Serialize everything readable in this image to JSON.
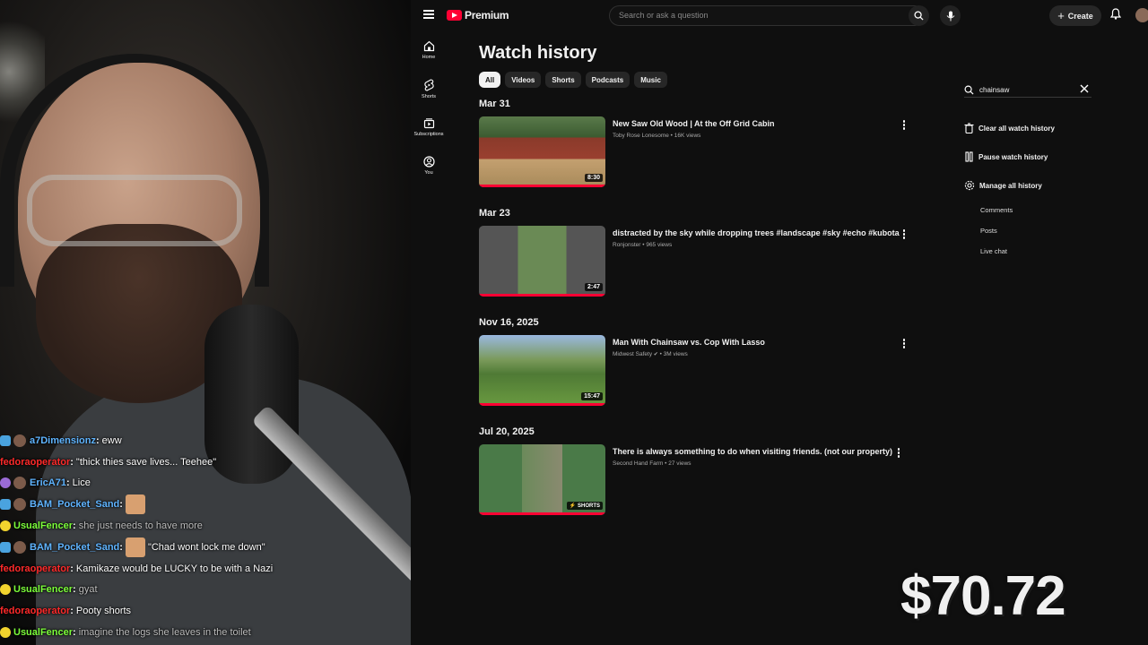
{
  "chat": [
    {
      "user": "a7Dimensionz",
      "color": "#5fb4ff",
      "badge": "sub",
      "avatar": true,
      "message": "eww",
      "faded": false
    },
    {
      "user": "fedoraoperator",
      "color": "#ff2a2a",
      "badge": "",
      "avatar": false,
      "message": "\"thick thies save lives... Teehee\"",
      "faded": false
    },
    {
      "user": "EricA71",
      "color": "#5fb4ff",
      "badge": "purple",
      "avatar": true,
      "message": "Lice",
      "faded": false
    },
    {
      "user": "BAM_Pocket_Sand",
      "color": "#5fb4ff",
      "badge": "sub",
      "avatar": true,
      "message": "",
      "emote": true,
      "faded": false
    },
    {
      "user": "UsualFencer",
      "color": "#7cff3a",
      "badge": "yellow",
      "avatar": false,
      "message": "she just needs to have more",
      "faded": true
    },
    {
      "user": "BAM_Pocket_Sand",
      "color": "#5fb4ff",
      "badge": "sub",
      "avatar": true,
      "message": "\"Chad wont lock me down\"",
      "emote": true,
      "faded": false
    },
    {
      "user": "fedoraoperator",
      "color": "#ff2a2a",
      "badge": "",
      "avatar": false,
      "message": "Kamikaze would be LUCKY to be with a Nazi",
      "faded": false
    },
    {
      "user": "UsualFencer",
      "color": "#7cff3a",
      "badge": "yellow",
      "avatar": false,
      "message": "gyat",
      "faded": true
    },
    {
      "user": "fedoraoperator",
      "color": "#ff2a2a",
      "badge": "",
      "avatar": false,
      "message": "Pooty shorts",
      "faded": false
    },
    {
      "user": "UsualFencer",
      "color": "#7cff3a",
      "badge": "yellow",
      "avatar": false,
      "message": "imagine the logs she leaves in the toilet",
      "faded": true
    }
  ],
  "header": {
    "logo_text": "Premium",
    "search_placeholder": "Search or ask a question",
    "create_label": "Create"
  },
  "sidebar": {
    "items": [
      {
        "label": "Home",
        "icon": "home-icon"
      },
      {
        "label": "Shorts",
        "icon": "shorts-icon"
      },
      {
        "label": "Subscriptions",
        "icon": "subscriptions-icon"
      },
      {
        "label": "You",
        "icon": "you-icon"
      }
    ]
  },
  "main": {
    "title": "Watch history",
    "chips": [
      {
        "label": "All",
        "active": true
      },
      {
        "label": "Videos",
        "active": false
      },
      {
        "label": "Shorts",
        "active": false
      },
      {
        "label": "Podcasts",
        "active": false
      },
      {
        "label": "Music",
        "active": false
      }
    ],
    "sections": [
      {
        "date": "Mar 31",
        "video": {
          "title": "New Saw Old Wood | At the Off Grid Cabin",
          "channel": "Toby Rose Lonesome",
          "verified": false,
          "views": "16K views",
          "duration": "8:30"
        }
      },
      {
        "date": "Mar 23",
        "video": {
          "title": "distracted by the sky while dropping trees #landscape #sky #echo #kubota",
          "channel": "Ronjonster",
          "verified": false,
          "views": "965 views",
          "duration": "2:47"
        }
      },
      {
        "date": "Nov 16, 2025",
        "video": {
          "title": "Man With Chainsaw vs. Cop With Lasso",
          "channel": "Midwest Safety",
          "verified": true,
          "views": "3M views",
          "duration": "15:47"
        }
      },
      {
        "date": "Jul 20, 2025",
        "video": {
          "title": "There is always something to do when visiting friends. (not our property)",
          "channel": "Second Hand Farm",
          "verified": false,
          "views": "27 views",
          "duration": "SHORTS"
        }
      }
    ]
  },
  "filter": {
    "value": "chainsaw",
    "actions": [
      {
        "label": "Clear all watch history",
        "icon": "trash-icon"
      },
      {
        "label": "Pause watch history",
        "icon": "pause-icon"
      },
      {
        "label": "Manage all history",
        "icon": "gear-icon"
      }
    ],
    "sub_actions": [
      "Comments",
      "Posts",
      "Live chat"
    ]
  },
  "overlay": {
    "donation": "$70.72"
  }
}
